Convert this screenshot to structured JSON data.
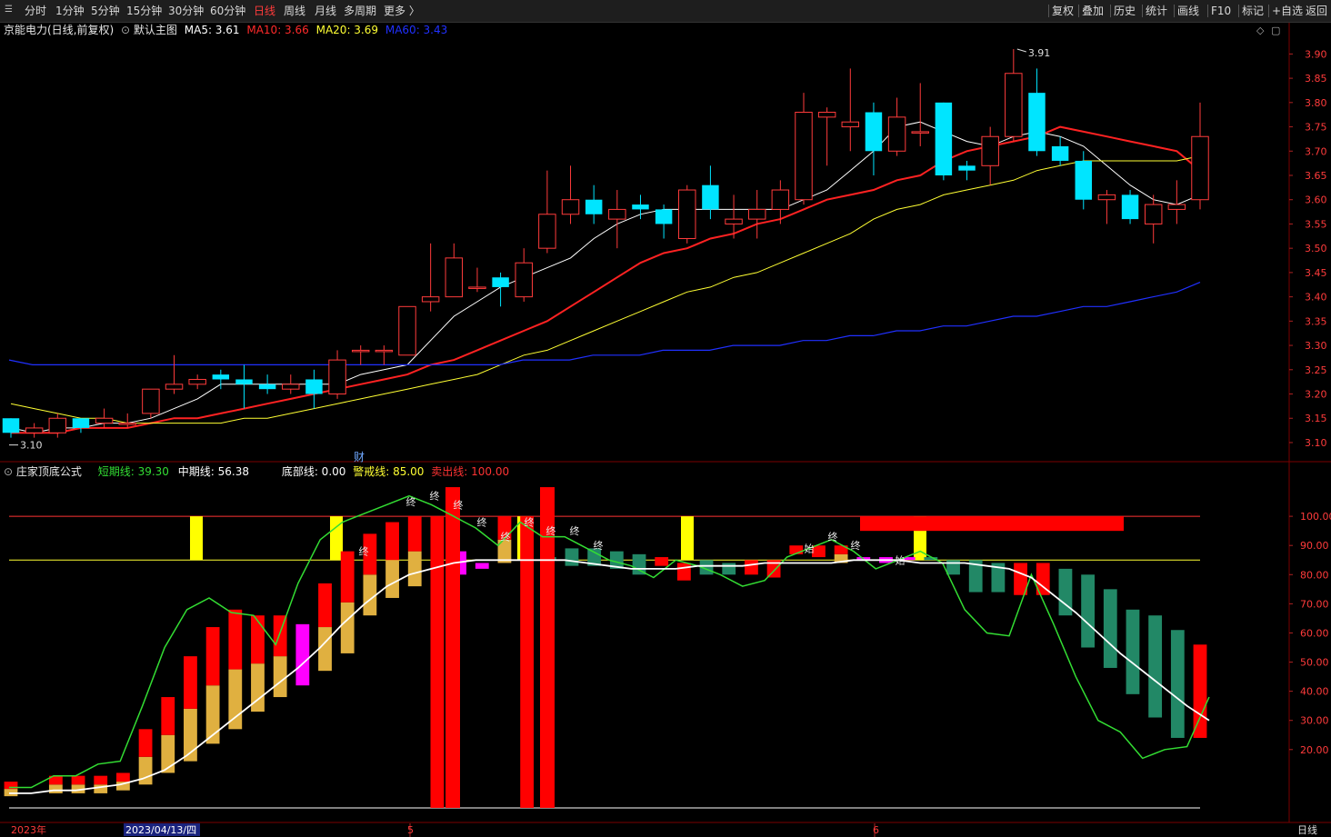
{
  "toolbar": {
    "left_items": [
      "分时",
      "1分钟",
      "5分钟",
      "15分钟",
      "30分钟",
      "60分钟",
      "日线",
      "周线",
      "月线",
      "多周期",
      "更多 〉"
    ],
    "active": "日线",
    "right_items": [
      "复权",
      "叠加",
      "历史",
      "统计",
      "画线",
      "F10",
      "标记",
      "+自选",
      "返回"
    ]
  },
  "main": {
    "title": "京能电力(日线,前复权)",
    "template": "默认主图",
    "ma": [
      {
        "label": "MA5: 3.61",
        "color": "#ffffff"
      },
      {
        "label": "MA10: 3.66",
        "color": "#ff2a2a"
      },
      {
        "label": "MA20: 3.69",
        "color": "#ffff33"
      },
      {
        "label": "MA60: 3.43",
        "color": "#2030ff"
      }
    ],
    "high_label": "3.91",
    "low_label": "3.10",
    "cai_marker": "财"
  },
  "indicator": {
    "name": "庄家顶底公式",
    "lines": [
      {
        "label": "短期线: 39.30",
        "color": "#33dd33"
      },
      {
        "label": "中期线: 56.38",
        "color": "#ffffff"
      },
      {
        "label": "底部线: 0.00",
        "color": "#ffffff"
      },
      {
        "label": "警戒线: 85.00",
        "color": "#ffff33"
      },
      {
        "label": "卖出线: 100.00",
        "color": "#ff3333"
      }
    ],
    "end_label": "终",
    "start_label": "始"
  },
  "date_axis": {
    "year": "2023年",
    "cursor_date": "2023/04/13/四",
    "month_ticks": [
      "5",
      "6"
    ],
    "period": "日线"
  },
  "colors": {
    "up": "#ff3b3b",
    "down": "#00e5ff",
    "ma5": "#ffffff",
    "ma10": "#ff2222",
    "ma20": "#ffff33",
    "ma60": "#2030ff"
  },
  "chart_data": [
    {
      "type": "candlestick",
      "title": "京能电力(日线,前复权)",
      "y_ticks": [
        3.1,
        3.15,
        3.2,
        3.25,
        3.3,
        3.35,
        3.4,
        3.45,
        3.5,
        3.55,
        3.6,
        3.65,
        3.7,
        3.75,
        3.8,
        3.85,
        3.9
      ],
      "ylim": [
        3.07,
        3.94
      ],
      "candles": [
        [
          3.15,
          3.12,
          3.15,
          3.11
        ],
        [
          3.12,
          3.13,
          3.14,
          3.11
        ],
        [
          3.12,
          3.15,
          3.16,
          3.11
        ],
        [
          3.15,
          3.13,
          3.15,
          3.12
        ],
        [
          3.14,
          3.15,
          3.17,
          3.13
        ],
        [
          3.14,
          3.14,
          3.16,
          3.13
        ],
        [
          3.16,
          3.21,
          3.21,
          3.15
        ],
        [
          3.21,
          3.22,
          3.28,
          3.2
        ],
        [
          3.22,
          3.23,
          3.24,
          3.21
        ],
        [
          3.24,
          3.23,
          3.25,
          3.21
        ],
        [
          3.23,
          3.22,
          3.26,
          3.17
        ],
        [
          3.22,
          3.21,
          3.24,
          3.2
        ],
        [
          3.21,
          3.22,
          3.24,
          3.2
        ],
        [
          3.23,
          3.2,
          3.25,
          3.17
        ],
        [
          3.2,
          3.27,
          3.29,
          3.19
        ],
        [
          3.29,
          3.29,
          3.3,
          3.26
        ],
        [
          3.29,
          3.29,
          3.3,
          3.26
        ],
        [
          3.28,
          3.38,
          3.38,
          3.28
        ],
        [
          3.39,
          3.4,
          3.51,
          3.37
        ],
        [
          3.4,
          3.48,
          3.51,
          3.41
        ],
        [
          3.42,
          3.42,
          3.46,
          3.41
        ],
        [
          3.44,
          3.42,
          3.45,
          3.38
        ],
        [
          3.4,
          3.47,
          3.5,
          3.39
        ],
        [
          3.5,
          3.57,
          3.66,
          3.49
        ],
        [
          3.57,
          3.6,
          3.67,
          3.55
        ],
        [
          3.6,
          3.57,
          3.63,
          3.55
        ],
        [
          3.56,
          3.58,
          3.62,
          3.5
        ],
        [
          3.59,
          3.58,
          3.61,
          3.56
        ],
        [
          3.58,
          3.55,
          3.59,
          3.52
        ],
        [
          3.52,
          3.62,
          3.63,
          3.51
        ],
        [
          3.63,
          3.58,
          3.67,
          3.56
        ],
        [
          3.55,
          3.56,
          3.61,
          3.52
        ],
        [
          3.56,
          3.58,
          3.62,
          3.52
        ],
        [
          3.58,
          3.62,
          3.64,
          3.55
        ],
        [
          3.6,
          3.78,
          3.82,
          3.59
        ],
        [
          3.77,
          3.78,
          3.79,
          3.67
        ],
        [
          3.75,
          3.76,
          3.87,
          3.7
        ],
        [
          3.78,
          3.7,
          3.8,
          3.65
        ],
        [
          3.7,
          3.77,
          3.81,
          3.69
        ],
        [
          3.74,
          3.74,
          3.84,
          3.71
        ],
        [
          3.8,
          3.65,
          3.8,
          3.64
        ],
        [
          3.67,
          3.66,
          3.68,
          3.64
        ],
        [
          3.67,
          3.73,
          3.75,
          3.63
        ],
        [
          3.73,
          3.86,
          3.91,
          3.72
        ],
        [
          3.82,
          3.7,
          3.87,
          3.69
        ],
        [
          3.71,
          3.68,
          3.73,
          3.67
        ],
        [
          3.68,
          3.6,
          3.7,
          3.58
        ],
        [
          3.6,
          3.61,
          3.62,
          3.55
        ],
        [
          3.61,
          3.56,
          3.62,
          3.55
        ],
        [
          3.55,
          3.59,
          3.61,
          3.51
        ],
        [
          3.58,
          3.59,
          3.64,
          3.55
        ],
        [
          3.6,
          3.73,
          3.8,
          3.58
        ]
      ],
      "series": [
        {
          "name": "MA5",
          "values": [
            3.13,
            3.12,
            3.13,
            3.13,
            3.14,
            3.14,
            3.15,
            3.17,
            3.19,
            3.22,
            3.22,
            3.22,
            3.22,
            3.22,
            3.22,
            3.24,
            3.25,
            3.26,
            3.31,
            3.36,
            3.39,
            3.42,
            3.44,
            3.46,
            3.48,
            3.52,
            3.55,
            3.57,
            3.58,
            3.58,
            3.58,
            3.58,
            3.58,
            3.58,
            3.6,
            3.62,
            3.66,
            3.7,
            3.75,
            3.76,
            3.74,
            3.72,
            3.71,
            3.73,
            3.74,
            3.73,
            3.71,
            3.67,
            3.63,
            3.6,
            3.59,
            3.61
          ]
        },
        {
          "name": "MA10",
          "values": [
            3.12,
            3.12,
            3.12,
            3.13,
            3.13,
            3.13,
            3.14,
            3.15,
            3.15,
            3.16,
            3.17,
            3.18,
            3.19,
            3.2,
            3.21,
            3.22,
            3.23,
            3.24,
            3.26,
            3.27,
            3.29,
            3.31,
            3.33,
            3.35,
            3.38,
            3.41,
            3.44,
            3.47,
            3.49,
            3.5,
            3.52,
            3.53,
            3.55,
            3.56,
            3.58,
            3.6,
            3.61,
            3.62,
            3.64,
            3.65,
            3.68,
            3.7,
            3.71,
            3.72,
            3.73,
            3.75,
            3.74,
            3.73,
            3.72,
            3.71,
            3.7,
            3.66
          ]
        },
        {
          "name": "MA20",
          "values": [
            3.18,
            3.17,
            3.16,
            3.15,
            3.15,
            3.14,
            3.14,
            3.14,
            3.14,
            3.14,
            3.15,
            3.15,
            3.16,
            3.17,
            3.18,
            3.19,
            3.2,
            3.21,
            3.22,
            3.23,
            3.24,
            3.26,
            3.28,
            3.29,
            3.31,
            3.33,
            3.35,
            3.37,
            3.39,
            3.41,
            3.42,
            3.44,
            3.45,
            3.47,
            3.49,
            3.51,
            3.53,
            3.56,
            3.58,
            3.59,
            3.61,
            3.62,
            3.63,
            3.64,
            3.66,
            3.67,
            3.68,
            3.68,
            3.68,
            3.68,
            3.68,
            3.69
          ]
        },
        {
          "name": "MA60",
          "values": [
            3.27,
            3.26,
            3.26,
            3.26,
            3.26,
            3.26,
            3.26,
            3.26,
            3.26,
            3.26,
            3.26,
            3.26,
            3.26,
            3.26,
            3.26,
            3.26,
            3.26,
            3.26,
            3.26,
            3.26,
            3.26,
            3.26,
            3.27,
            3.27,
            3.27,
            3.28,
            3.28,
            3.28,
            3.29,
            3.29,
            3.29,
            3.3,
            3.3,
            3.3,
            3.31,
            3.31,
            3.32,
            3.32,
            3.33,
            3.33,
            3.34,
            3.34,
            3.35,
            3.36,
            3.36,
            3.37,
            3.38,
            3.38,
            3.39,
            3.4,
            3.41,
            3.43
          ]
        }
      ]
    },
    {
      "type": "bar",
      "title": "庄家顶底公式",
      "y_ticks": [
        20,
        30,
        40,
        50,
        60,
        70,
        80,
        90,
        100
      ],
      "ylim": [
        -5,
        115
      ],
      "series": [
        {
          "name": "短期线",
          "values": [
            7,
            7,
            11,
            11,
            15,
            16,
            35,
            55,
            68,
            72,
            67,
            66,
            56,
            77,
            92,
            98,
            101,
            104,
            107,
            104,
            100,
            96,
            90,
            98,
            93,
            93,
            89,
            85,
            83,
            79,
            85,
            83,
            80,
            76,
            78,
            86,
            89,
            92,
            88,
            82,
            85,
            88,
            84,
            68,
            60,
            59,
            80,
            63,
            45,
            30,
            26,
            17,
            20,
            21,
            38
          ]
        },
        {
          "name": "中期线",
          "values": [
            5,
            5,
            6,
            6,
            7,
            8,
            10,
            13,
            18,
            24,
            30,
            36,
            42,
            48,
            55,
            63,
            70,
            76,
            80,
            82,
            84,
            85,
            85,
            85,
            85,
            85,
            84,
            83,
            82,
            82,
            82,
            83,
            83,
            83,
            84,
            84,
            84,
            84,
            85,
            85,
            85,
            84,
            84,
            84,
            83,
            82,
            79,
            73,
            67,
            60,
            53,
            47,
            41,
            35,
            30,
            56
          ]
        }
      ],
      "hist": [
        [
          4,
          9,
          "gold"
        ],
        [
          0,
          0,
          "red"
        ],
        [
          5,
          11,
          "gold"
        ],
        [
          5,
          11,
          "gold"
        ],
        [
          5,
          11,
          "gold"
        ],
        [
          6,
          12,
          "gold"
        ],
        [
          8,
          27,
          "gold"
        ],
        [
          12,
          38,
          "gold"
        ],
        [
          16,
          52,
          "gold"
        ],
        [
          22,
          62,
          "gold"
        ],
        [
          27,
          68,
          "gold"
        ],
        [
          33,
          66,
          "gold"
        ],
        [
          38,
          66,
          "gold"
        ],
        [
          42,
          63,
          "magenta"
        ],
        [
          47,
          77,
          "gold"
        ],
        [
          53,
          88,
          "gold"
        ],
        [
          66,
          94,
          "gold"
        ],
        [
          72,
          98,
          "gold"
        ],
        [
          76,
          100,
          "gold"
        ],
        [
          0,
          100,
          "red"
        ],
        [
          80,
          88,
          "magenta"
        ],
        [
          82,
          84,
          "magenta"
        ],
        [
          84,
          100,
          "gold"
        ],
        [
          0,
          100,
          "red"
        ],
        [
          85,
          86,
          "green"
        ],
        [
          83,
          89,
          "green"
        ],
        [
          83,
          89,
          "green"
        ],
        [
          82,
          88,
          "green"
        ],
        [
          80,
          87,
          "green"
        ],
        [
          83,
          86,
          "red"
        ],
        [
          78,
          84,
          "red"
        ],
        [
          80,
          85,
          "green"
        ],
        [
          80,
          84,
          "green"
        ],
        [
          80,
          85,
          "red"
        ],
        [
          79,
          85,
          "red"
        ],
        [
          87,
          90,
          "red"
        ],
        [
          86,
          90,
          "red"
        ],
        [
          84,
          90,
          "gold"
        ],
        [
          85,
          86,
          "magenta"
        ],
        [
          84,
          86,
          "magenta"
        ],
        [
          85,
          86,
          "magenta"
        ],
        [
          85,
          86,
          "green"
        ],
        [
          80,
          85,
          "green"
        ],
        [
          74,
          85,
          "green"
        ],
        [
          74,
          84,
          "green"
        ],
        [
          73,
          84,
          "red"
        ],
        [
          73,
          84,
          "red"
        ],
        [
          66,
          82,
          "green"
        ],
        [
          55,
          80,
          "green"
        ],
        [
          48,
          75,
          "green"
        ],
        [
          39,
          68,
          "green"
        ],
        [
          31,
          66,
          "green"
        ],
        [
          24,
          61,
          "green"
        ],
        [
          24,
          56,
          "red"
        ]
      ]
    }
  ]
}
